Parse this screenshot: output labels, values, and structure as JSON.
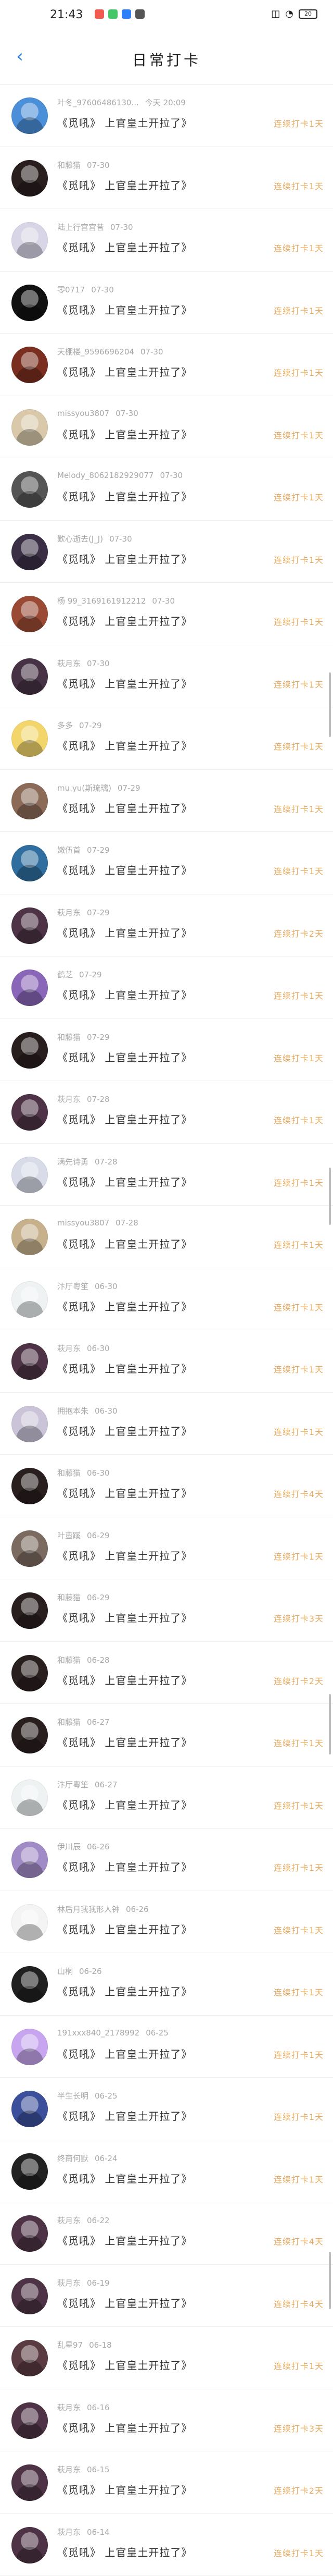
{
  "status_bar": {
    "time": "21:43",
    "battery": "20",
    "app_colors": [
      "#f05a4f",
      "#44c767",
      "#2d7ff9",
      "#555555"
    ]
  },
  "header": {
    "title": "日常打卡",
    "back_icon": "chevron-left-icon"
  },
  "colors": {
    "accent": "#2b7fd8",
    "streak": "#e6a95d",
    "muted": "#a8a8a8"
  },
  "entries": [
    {
      "user": "叶冬_97606486130...",
      "date": "今天 20:09",
      "message": "《觅吼》 上官皇土开拉了》",
      "streak": "连续打卡1天",
      "avatar_color": "#4b8fd8"
    },
    {
      "user": "和藤猫",
      "date": "07-30",
      "message": "《觅吼》 上官皇土开拉了》",
      "streak": "连续打卡1天",
      "avatar_color": "#2a1f1f"
    },
    {
      "user": "陆上行宫宫昔",
      "date": "07-30",
      "message": "《觅吼》 上官皇土开拉了》",
      "streak": "连续打卡1天",
      "avatar_color": "#d8d6e6"
    },
    {
      "user": "零0717",
      "date": "07-30",
      "message": "《觅吼》 上官皇土开拉了》",
      "streak": "连续打卡1天",
      "avatar_color": "#111111"
    },
    {
      "user": "天棚楼_9596696204",
      "date": "07-30",
      "message": "《觅吼》 上官皇土开拉了》",
      "streak": "连续打卡1天",
      "avatar_color": "#7a2e1f"
    },
    {
      "user": "missyou3807",
      "date": "07-30",
      "message": "《觅吼》 上官皇土开拉了》",
      "streak": "连续打卡1天",
      "avatar_color": "#d9c9aa"
    },
    {
      "user": "Melody_8062182929077",
      "date": "07-30",
      "message": "《觅吼》 上官皇土开拉了》",
      "streak": "连续打卡1天",
      "avatar_color": "#555555"
    },
    {
      "user": "歎心逝去(J_J)",
      "date": "07-30",
      "message": "《觅吼》 上官皇土开拉了》",
      "streak": "连续打卡1天",
      "avatar_color": "#3b2f46"
    },
    {
      "user": "杨 99_3169161912212",
      "date": "07-30",
      "message": "《觅吼》 上官皇土开拉了》",
      "streak": "连续打卡1天",
      "avatar_color": "#9a4a34"
    },
    {
      "user": "萩月东",
      "date": "07-30",
      "message": "《觅吼》 上官皇土开拉了》",
      "streak": "连续打卡1天",
      "avatar_color": "#463244"
    },
    {
      "user": "多多",
      "date": "07-29",
      "message": "《觅吼》 上官皇土开拉了》",
      "streak": "连续打卡1天",
      "avatar_color": "#f2d66c"
    },
    {
      "user": "mu.yu(斯琉璃)",
      "date": "07-29",
      "message": "《觅吼》 上官皇土开拉了》",
      "streak": "连续打卡1天",
      "avatar_color": "#8b6b57"
    },
    {
      "user": "嫩伍首",
      "date": "07-29",
      "message": "《觅吼》 上官皇土开拉了》",
      "streak": "连续打卡1天",
      "avatar_color": "#2f6e9f"
    },
    {
      "user": "萩月东",
      "date": "07-29",
      "message": "《觅吼》 上官皇土开拉了》",
      "streak": "连续打卡2天",
      "avatar_color": "#4d3345"
    },
    {
      "user": "鹤芝",
      "date": "07-29",
      "message": "《觅吼》 上官皇土开拉了》",
      "streak": "连续打卡1天",
      "avatar_color": "#8a66b8"
    },
    {
      "user": "和藤猫",
      "date": "07-29",
      "message": "《觅吼》 上官皇土开拉了》",
      "streak": "连续打卡1天",
      "avatar_color": "#2a1f1f"
    },
    {
      "user": "萩月东",
      "date": "07-28",
      "message": "《觅吼》 上官皇土开拉了》",
      "streak": "连续打卡1天",
      "avatar_color": "#4d3345"
    },
    {
      "user": "满先诗勇",
      "date": "07-28",
      "message": "《觅吼》 上官皇土开拉了》",
      "streak": "连续打卡1天",
      "avatar_color": "#d8dbe8"
    },
    {
      "user": "missyou3807",
      "date": "07-28",
      "message": "《觅吼》 上官皇土开拉了》",
      "streak": "连续打卡1天",
      "avatar_color": "#c7b18d"
    },
    {
      "user": "汴厅粤笙",
      "date": "06-30",
      "message": "《觅吼》 上官皇土开拉了》",
      "streak": "连续打卡1天",
      "avatar_color": "#eef2f3"
    },
    {
      "user": "萩月东",
      "date": "06-30",
      "message": "《觅吼》 上官皇土开拉了》",
      "streak": "连续打卡1天",
      "avatar_color": "#4d3345"
    },
    {
      "user": "拥抱本朱",
      "date": "06-30",
      "message": "《觅吼》 上官皇土开拉了》",
      "streak": "连续打卡1天",
      "avatar_color": "#cbc4d8"
    },
    {
      "user": "和藤猫",
      "date": "06-30",
      "message": "《觅吼》 上官皇土开拉了》",
      "streak": "连续打卡4天",
      "avatar_color": "#2a1f1f"
    },
    {
      "user": "叶蛮蹊",
      "date": "06-29",
      "message": "《觅吼》 上官皇土开拉了》",
      "streak": "连续打卡1天",
      "avatar_color": "#7a6a60"
    },
    {
      "user": "和藤猫",
      "date": "06-29",
      "message": "《觅吼》 上官皇土开拉了》",
      "streak": "连续打卡3天",
      "avatar_color": "#2a1f1f"
    },
    {
      "user": "和藤猫",
      "date": "06-28",
      "message": "《觅吼》 上官皇土开拉了》",
      "streak": "连续打卡2天",
      "avatar_color": "#2a1f1f"
    },
    {
      "user": "和藤猫",
      "date": "06-27",
      "message": "《觅吼》 上官皇土开拉了》",
      "streak": "连续打卡1天",
      "avatar_color": "#2a1f1f"
    },
    {
      "user": "汴厅粤笙",
      "date": "06-27",
      "message": "《觅吼》 上官皇土开拉了》",
      "streak": "连续打卡1天",
      "avatar_color": "#eef2f3"
    },
    {
      "user": "伊川辰",
      "date": "06-26",
      "message": "《觅吼》 上官皇土开拉了》",
      "streak": "连续打卡1天",
      "avatar_color": "#a18bc7"
    },
    {
      "user": "林后月我我形人钟",
      "date": "06-26",
      "message": "《觅吼》 上官皇土开拉了》",
      "streak": "连续打卡1天",
      "avatar_color": "#f4f4f4"
    },
    {
      "user": "山桐",
      "date": "06-26",
      "message": "《觅吼》 上官皇土开拉了》",
      "streak": "连续打卡1天",
      "avatar_color": "#202020"
    },
    {
      "user": "191xxx840_2178992",
      "date": "06-25",
      "message": "《觅吼》 上官皇土开拉了》",
      "streak": "连续打卡1天",
      "avatar_color": "#c7a6ef"
    },
    {
      "user": "半生长明",
      "date": "06-25",
      "message": "《觅吼》 上官皇土开拉了》",
      "streak": "连续打卡1天",
      "avatar_color": "#3b4f9a"
    },
    {
      "user": "终南何默",
      "date": "06-24",
      "message": "《觅吼》 上官皇土开拉了》",
      "streak": "连续打卡1天",
      "avatar_color": "#222222"
    },
    {
      "user": "萩月东",
      "date": "06-22",
      "message": "《觅吼》 上官皇土开拉了》",
      "streak": "连续打卡4天",
      "avatar_color": "#4d3345"
    },
    {
      "user": "萩月东",
      "date": "06-19",
      "message": "《觅吼》 上官皇土开拉了》",
      "streak": "连续打卡4天",
      "avatar_color": "#4d3345"
    },
    {
      "user": "乱星97",
      "date": "06-18",
      "message": "《觅吼》 上官皇土开拉了》",
      "streak": "连续打卡1天",
      "avatar_color": "#5a3b42"
    },
    {
      "user": "萩月东",
      "date": "06-16",
      "message": "《觅吼》 上官皇土开拉了》",
      "streak": "连续打卡3天",
      "avatar_color": "#4d3345"
    },
    {
      "user": "萩月东",
      "date": "06-15",
      "message": "《觅吼》 上官皇土开拉了》",
      "streak": "连续打卡2天",
      "avatar_color": "#4d3345"
    },
    {
      "user": "萩月东",
      "date": "06-14",
      "message": "《觅吼》 上官皇土开拉了》",
      "streak": "连续打卡1天",
      "avatar_color": "#4d3345"
    }
  ]
}
